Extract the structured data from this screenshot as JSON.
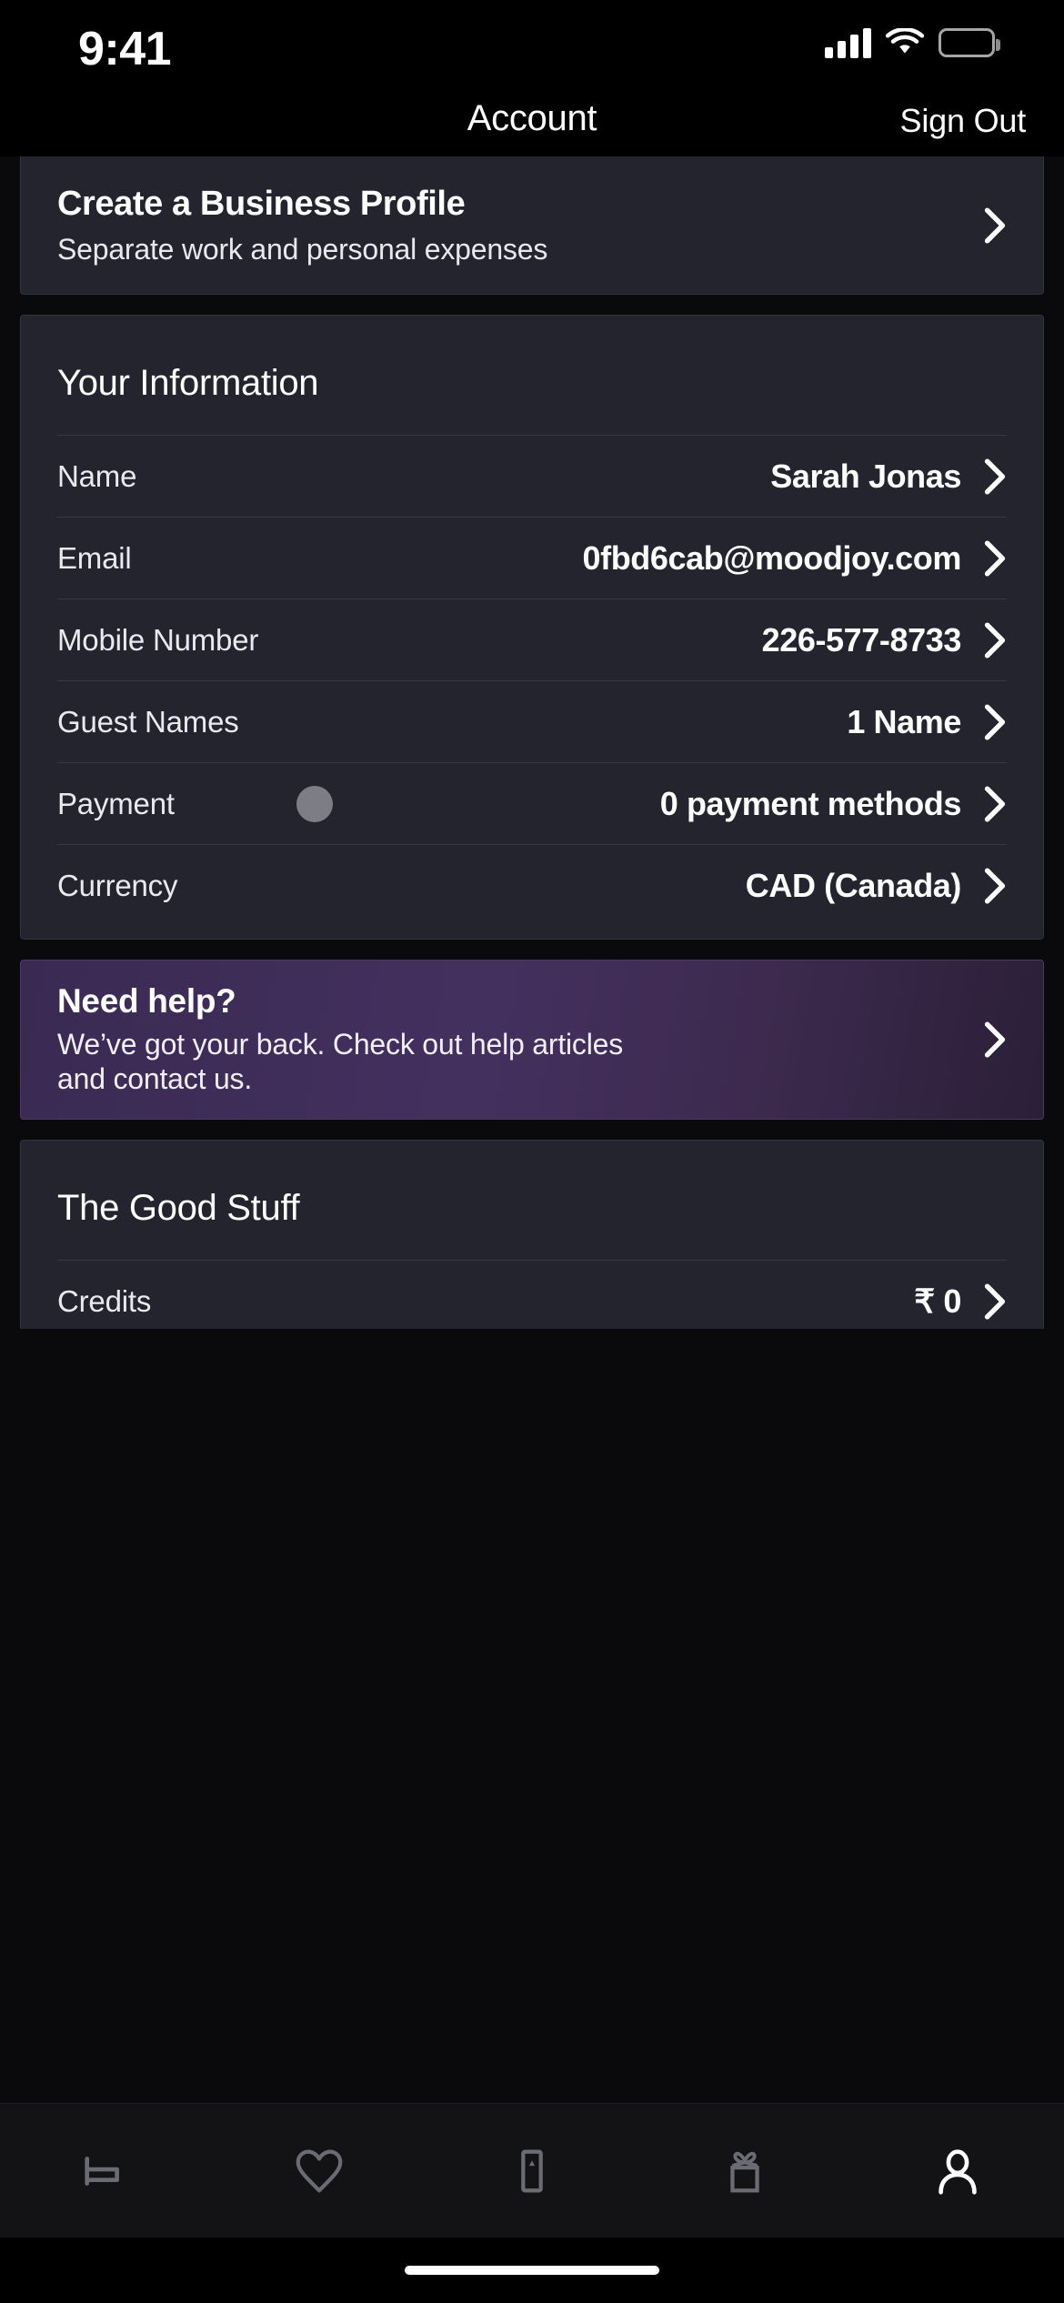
{
  "status_bar": {
    "time": "9:41",
    "cellular_icon": "signal-bars-icon",
    "wifi_icon": "wifi-icon",
    "battery_icon": "battery-icon"
  },
  "header": {
    "title": "Account",
    "action_label": "Sign Out"
  },
  "business_profile_card": {
    "title": "Create a Business Profile",
    "subtitle": "Separate work and personal expenses",
    "chevron_icon": "chevron-right-icon"
  },
  "your_information": {
    "heading": "Your Information",
    "rows": [
      {
        "label": "Name",
        "value": "Sarah Jonas",
        "chevron_icon": "chevron-right-icon"
      },
      {
        "label": "Email",
        "value": "0fbd6cab@moodjoy.com",
        "chevron_icon": "chevron-right-icon"
      },
      {
        "label": "Mobile Number",
        "value": "226-577-8733",
        "chevron_icon": "chevron-right-icon"
      },
      {
        "label": "Guest Names",
        "value": "1 Name",
        "chevron_icon": "chevron-right-icon"
      },
      {
        "label": "Payment",
        "value": "0 payment methods",
        "chevron_icon": "chevron-right-icon"
      },
      {
        "label": "Currency",
        "value": "CAD (Canada)",
        "chevron_icon": "chevron-right-icon"
      }
    ]
  },
  "need_help_card": {
    "title": "Need help?",
    "body": "We’ve got your back. Check out help articles and contact us.",
    "chevron_icon": "chevron-right-icon"
  },
  "good_stuff": {
    "heading": "The Good Stuff",
    "rows": [
      {
        "label": "Credits",
        "value": "₹ 0",
        "chevron_icon": "chevron-right-icon"
      }
    ]
  },
  "tab_bar": {
    "items": [
      {
        "icon": "bed-icon",
        "active": false
      },
      {
        "icon": "heart-icon",
        "active": false
      },
      {
        "icon": "trips-ticket-icon",
        "active": false
      },
      {
        "icon": "gift-icon",
        "active": false
      },
      {
        "icon": "person-icon",
        "active": true
      }
    ]
  },
  "home_indicator": {
    "icon": "home-indicator"
  },
  "colors": {
    "background": "#0a0a0c",
    "card": "#24242f",
    "card_border": "#33333f",
    "divider": "#3a3a47",
    "accent_purple": "#44305f",
    "text_primary": "#ffffff",
    "text_secondary": "#e9e9ef",
    "tab_inactive": "#6b6b73",
    "tab_active": "#ffffff",
    "touch_dot": "#7d7d85"
  }
}
